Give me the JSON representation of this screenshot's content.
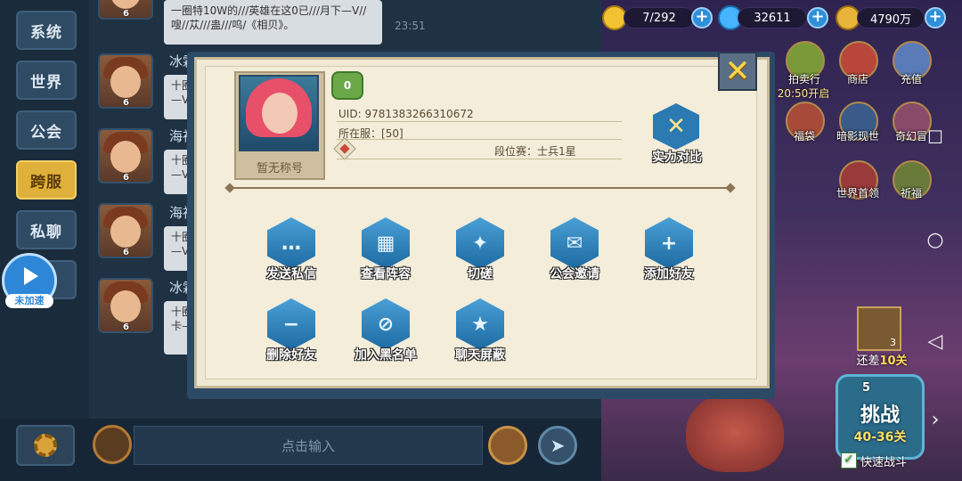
{
  "chat": {
    "channels": [
      {
        "label": "系统",
        "active": false
      },
      {
        "label": "世界",
        "active": false
      },
      {
        "label": "公会",
        "active": false
      },
      {
        "label": "跨服",
        "active": true
      },
      {
        "label": "私聊",
        "active": false
      }
    ],
    "messages": [
      {
        "name": "",
        "level": "6",
        "text": "一圈特10W的///英雄在这0已///月下—V//嗖//苁///蛊///呜/《相贝》。",
        "time": "23:51"
      },
      {
        "name": "冰霜",
        "level": "6",
        "text": "十圈—V/",
        "time": ""
      },
      {
        "name": "海神",
        "level": "6",
        "text": "十圈—V/",
        "time": ""
      },
      {
        "name": "海神",
        "level": "6",
        "text": "十圈—V/",
        "time": ""
      },
      {
        "name": "冰霜",
        "level": "6",
        "text": "十圈卡—",
        "time": ""
      }
    ],
    "input_placeholder": "点击输入",
    "speed_badge_label": "未加速"
  },
  "resources": {
    "energy": "7/292",
    "gems": "32611",
    "gold": "4790万"
  },
  "game_menu": [
    {
      "label": "拍卖行",
      "icon": "auction-icon"
    },
    {
      "label": "商店",
      "icon": "shop-icon"
    },
    {
      "label": "充值",
      "icon": "recharge-icon"
    },
    {
      "label": "福袋",
      "icon": "lucky-bag-icon"
    },
    {
      "label": "暗影现世",
      "icon": "shadow-icon"
    },
    {
      "label": "奇幻冒",
      "icon": "adventure-icon"
    },
    {
      "label": "世界首领",
      "icon": "world-boss-icon"
    },
    {
      "label": "祈福",
      "icon": "blessing-icon"
    }
  ],
  "auction_timer": "20:50开启",
  "stage": {
    "scroll_count": "3",
    "remaining_prefix": "还差",
    "remaining_value": "10关",
    "challenge_energy": "5",
    "challenge_label": "挑战",
    "challenge_stage": "40-36关",
    "quick_battle_label": "快速战斗",
    "quick_battle_checked": true
  },
  "profile": {
    "rank_level": "0",
    "title": "暂无称号",
    "uid_label": "UID:",
    "uid": "9781383266310672",
    "server_label": "所在服：",
    "server": "[50]",
    "ladder_label": "段位赛：",
    "ladder_rank": "士兵1星",
    "compare_label": "实力对比",
    "actions": [
      {
        "label": "发送私信",
        "icon": "message-icon"
      },
      {
        "label": "查看阵容",
        "icon": "lineup-grid-icon"
      },
      {
        "label": "切磋",
        "icon": "spar-icon"
      },
      {
        "label": "公会邀请",
        "icon": "guild-invite-icon"
      },
      {
        "label": "添加好友",
        "icon": "add-friend-icon"
      },
      {
        "label": "删除好友",
        "icon": "remove-friend-icon"
      },
      {
        "label": "加入黑名单",
        "icon": "blacklist-icon"
      },
      {
        "label": "聊天屏蔽",
        "icon": "chat-block-icon"
      }
    ]
  },
  "colors": {
    "active_channel": "#e0b13a",
    "action_hex": "#2b7ab2",
    "modal_paper": "#efe8d4"
  }
}
